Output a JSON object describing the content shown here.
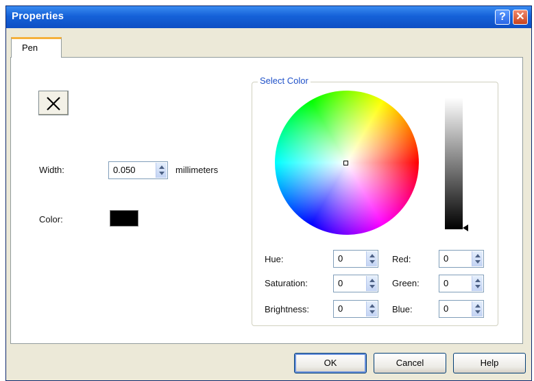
{
  "window": {
    "title": "Properties",
    "help_glyph": "?",
    "close_glyph": "✕"
  },
  "tabs": [
    {
      "label": "Pen",
      "selected": true
    }
  ],
  "pen": {
    "style_icon": "x-icon",
    "width_label": "Width:",
    "width_value": "0.050",
    "width_unit": "millimeters",
    "color_label": "Color:",
    "color_value": "#000000"
  },
  "select_color": {
    "title": "Select Color",
    "fields": {
      "hue": {
        "label": "Hue:",
        "value": "0"
      },
      "saturation": {
        "label": "Saturation:",
        "value": "0"
      },
      "brightness": {
        "label": "Brightness:",
        "value": "0"
      },
      "red": {
        "label": "Red:",
        "value": "0"
      },
      "green": {
        "label": "Green:",
        "value": "0"
      },
      "blue": {
        "label": "Blue:",
        "value": "0"
      }
    },
    "brightness_level": 0
  },
  "buttons": {
    "ok": "OK",
    "cancel": "Cancel",
    "help": "Help"
  },
  "colors": {
    "title_bar": "#1561D8",
    "tab_accent": "#F5B03A",
    "group_title": "#1E50C8"
  }
}
